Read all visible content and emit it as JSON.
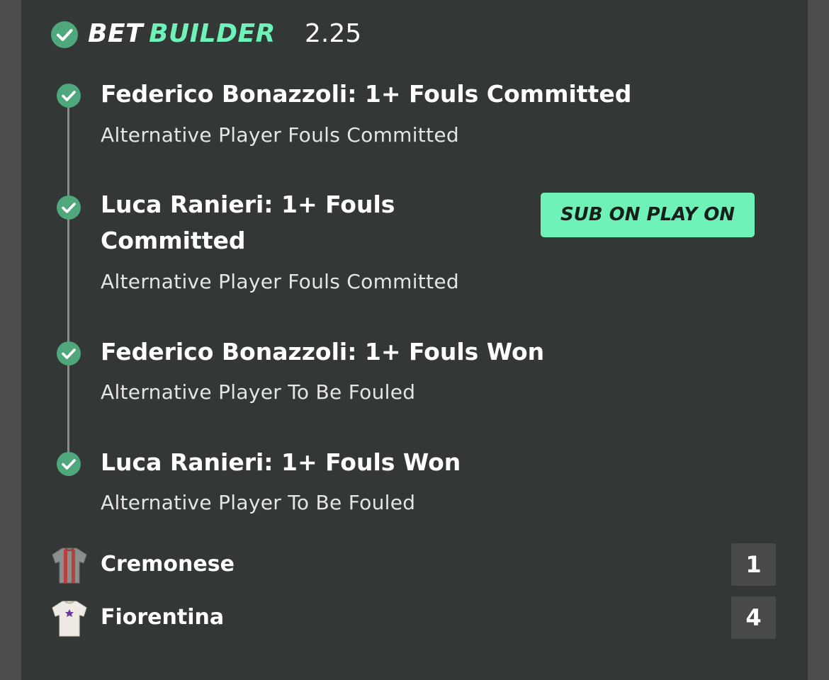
{
  "header": {
    "brand_word1": "BET",
    "brand_word2": "BUILDER",
    "odds": "2.25"
  },
  "legs": [
    {
      "title": "Federico Bonazzoli: 1+ Fouls Committed",
      "market": "Alternative Player Fouls Committed",
      "icon": "check-circle-icon"
    },
    {
      "title": "Luca Ranieri: 1+ Fouls Committed",
      "market": "Alternative Player Fouls Committed",
      "icon": "check-circle-icon",
      "badge": "SUB ON PLAY ON"
    },
    {
      "title": "Federico Bonazzoli: 1+ Fouls Won",
      "market": "Alternative Player To Be Fouled",
      "icon": "check-circle-icon"
    },
    {
      "title": "Luca Ranieri: 1+ Fouls Won",
      "market": "Alternative Player To Be Fouled",
      "icon": "check-circle-icon"
    }
  ],
  "teams": [
    {
      "name": "Cremonese",
      "score": "1",
      "icon": "cremonese-shirt-icon"
    },
    {
      "name": "Fiorentina",
      "score": "4",
      "icon": "fiorentina-shirt-icon"
    }
  ],
  "colors": {
    "background": "#4a4d4b",
    "card": "#333735",
    "accent_green": "#6ff2b8",
    "check_green": "#4fa77c",
    "score_box": "#474a48",
    "timeline": "#8a8d8b"
  }
}
